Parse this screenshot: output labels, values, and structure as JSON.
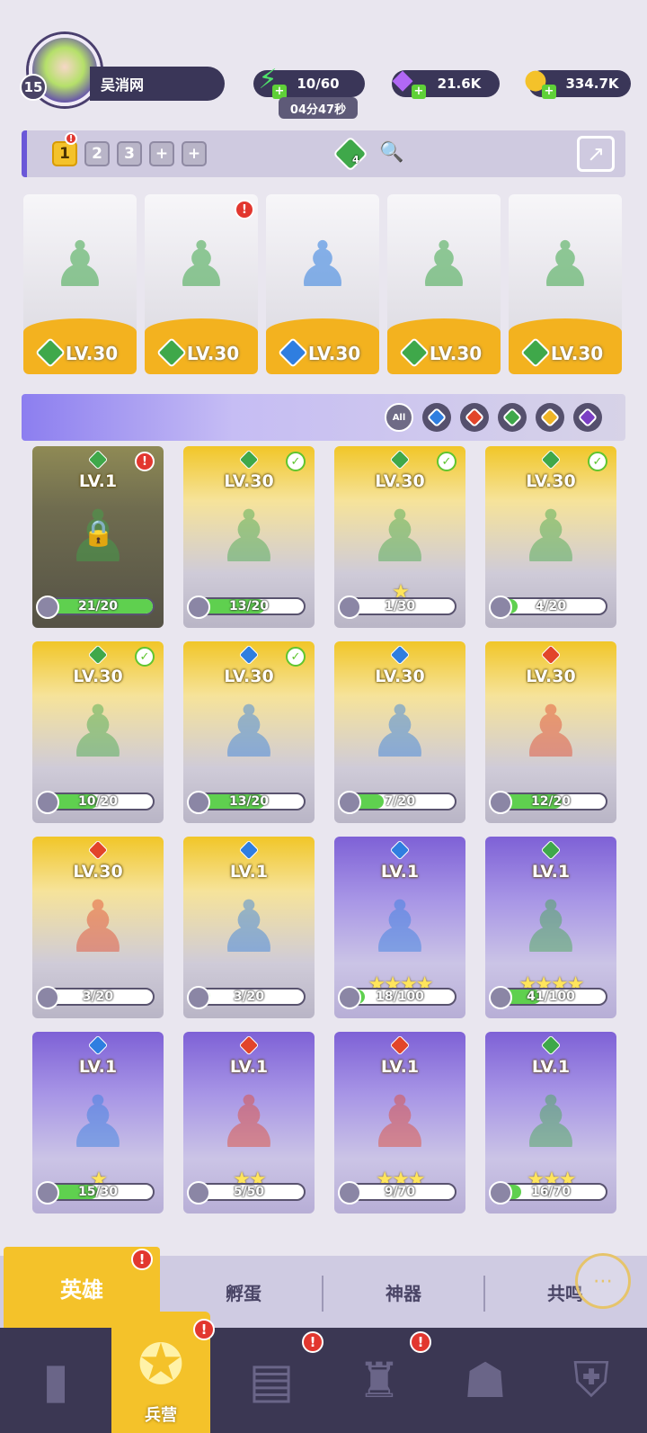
{
  "player": {
    "level": "15",
    "name": "吴消网"
  },
  "resources": {
    "energy": {
      "value": "10/60",
      "timer": "04分47秒",
      "icon": "lightning-icon"
    },
    "gems": {
      "value": "21.6K",
      "icon": "purple-gem-icon"
    },
    "coins": {
      "value": "334.7K",
      "icon": "gold-coin-icon"
    }
  },
  "team_slots": [
    "1",
    "2",
    "3",
    "+",
    "+"
  ],
  "team_cost": "4",
  "team": [
    {
      "level": "LV.30",
      "element": "nature",
      "alert": false
    },
    {
      "level": "LV.30",
      "element": "nature",
      "alert": true
    },
    {
      "level": "LV.30",
      "element": "water",
      "alert": false
    },
    {
      "level": "LV.30",
      "element": "nature",
      "alert": false
    },
    {
      "level": "LV.30",
      "element": "nature",
      "alert": false
    }
  ],
  "filters": [
    "All",
    "water",
    "fire",
    "nature",
    "light",
    "dark"
  ],
  "colors": {
    "gold": "#f4c22a",
    "purple": "#7e61d6",
    "nature": "#3fa84a",
    "water": "#2f7ee0",
    "fire": "#e2452a",
    "light": "#f0b526",
    "dark": "#7b3fc4"
  },
  "heroes": [
    {
      "level": "LV.1",
      "progress": "21/20",
      "fill": 1.0,
      "element": "nature",
      "style": "locked",
      "badge": "alert",
      "stars": 0
    },
    {
      "level": "LV.30",
      "progress": "13/20",
      "fill": 0.65,
      "element": "nature",
      "style": "gold",
      "badge": "check",
      "stars": 0
    },
    {
      "level": "LV.30",
      "progress": "1/30",
      "fill": 0.03,
      "element": "nature",
      "style": "gold",
      "badge": "check",
      "stars": 1
    },
    {
      "level": "LV.30",
      "progress": "4/20",
      "fill": 0.2,
      "element": "nature",
      "style": "gold",
      "badge": "check",
      "stars": 0
    },
    {
      "level": "LV.30",
      "progress": "10/20",
      "fill": 0.5,
      "element": "nature",
      "style": "gold",
      "badge": "check",
      "stars": 0
    },
    {
      "level": "LV.30",
      "progress": "13/20",
      "fill": 0.65,
      "element": "water",
      "style": "gold",
      "badge": "check",
      "stars": 0
    },
    {
      "level": "LV.30",
      "progress": "7/20",
      "fill": 0.35,
      "element": "water",
      "style": "gold",
      "badge": "",
      "stars": 0
    },
    {
      "level": "LV.30",
      "progress": "12/20",
      "fill": 0.6,
      "element": "fire",
      "style": "gold",
      "badge": "",
      "stars": 0
    },
    {
      "level": "LV.30",
      "progress": "3/20",
      "fill": 0.15,
      "element": "fire",
      "style": "gold",
      "badge": "",
      "stars": 0
    },
    {
      "level": "LV.1",
      "progress": "3/20",
      "fill": 0.15,
      "element": "water",
      "style": "gold",
      "badge": "",
      "stars": 0
    },
    {
      "level": "LV.1",
      "progress": "18/100",
      "fill": 0.18,
      "element": "water",
      "style": "purple",
      "badge": "",
      "stars": 4
    },
    {
      "level": "LV.1",
      "progress": "41/100",
      "fill": 0.41,
      "element": "nature",
      "style": "purple",
      "badge": "",
      "stars": 4
    },
    {
      "level": "LV.1",
      "progress": "15/30",
      "fill": 0.5,
      "element": "water",
      "style": "purple",
      "badge": "",
      "stars": 1
    },
    {
      "level": "LV.1",
      "progress": "5/50",
      "fill": 0.1,
      "element": "fire",
      "style": "purple",
      "badge": "",
      "stars": 2
    },
    {
      "level": "LV.1",
      "progress": "9/70",
      "fill": 0.13,
      "element": "fire",
      "style": "purple",
      "badge": "",
      "stars": 3
    },
    {
      "level": "LV.1",
      "progress": "16/70",
      "fill": 0.23,
      "element": "nature",
      "style": "purple",
      "badge": "",
      "stars": 3
    }
  ],
  "tabs": {
    "heroes": "英雄",
    "hatch": "孵蛋",
    "artifacts": "神器",
    "resonance": "共鸣"
  },
  "nav": {
    "barracks": "兵营"
  }
}
